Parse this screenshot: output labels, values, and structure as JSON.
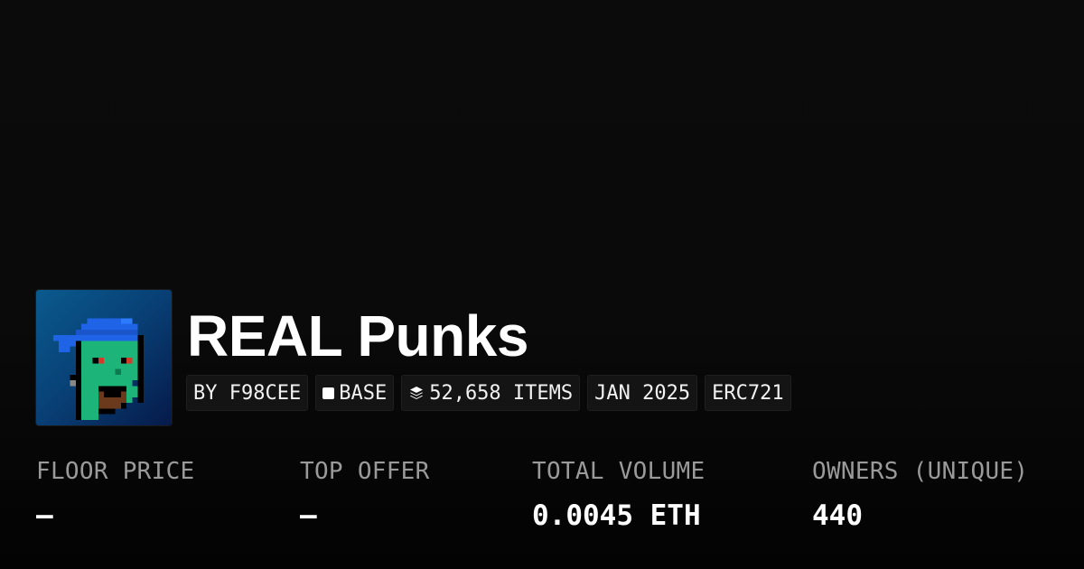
{
  "collection": {
    "name": "REAL Punks",
    "avatar_icon": "pixel-punk-avatar"
  },
  "badges": {
    "creator": "BY F98CEE",
    "chain": "BASE",
    "items": "52,658 ITEMS",
    "date": "JAN 2025",
    "standard": "ERC721"
  },
  "stats": {
    "floor_price": {
      "label": "FLOOR PRICE",
      "value": "–"
    },
    "top_offer": {
      "label": "TOP OFFER",
      "value": "–"
    },
    "total_volume": {
      "label": "TOTAL VOLUME",
      "value": "0.0045 ETH"
    },
    "owners": {
      "label": "OWNERS (UNIQUE)",
      "value": "440"
    }
  },
  "colors": {
    "background": "#0a0a0a",
    "avatar_bg": "#0a4a80",
    "punk_skin": "#1db47a",
    "bandana": "#1f63e6",
    "text_primary": "#ffffff",
    "text_muted": "#9a9a9a"
  }
}
